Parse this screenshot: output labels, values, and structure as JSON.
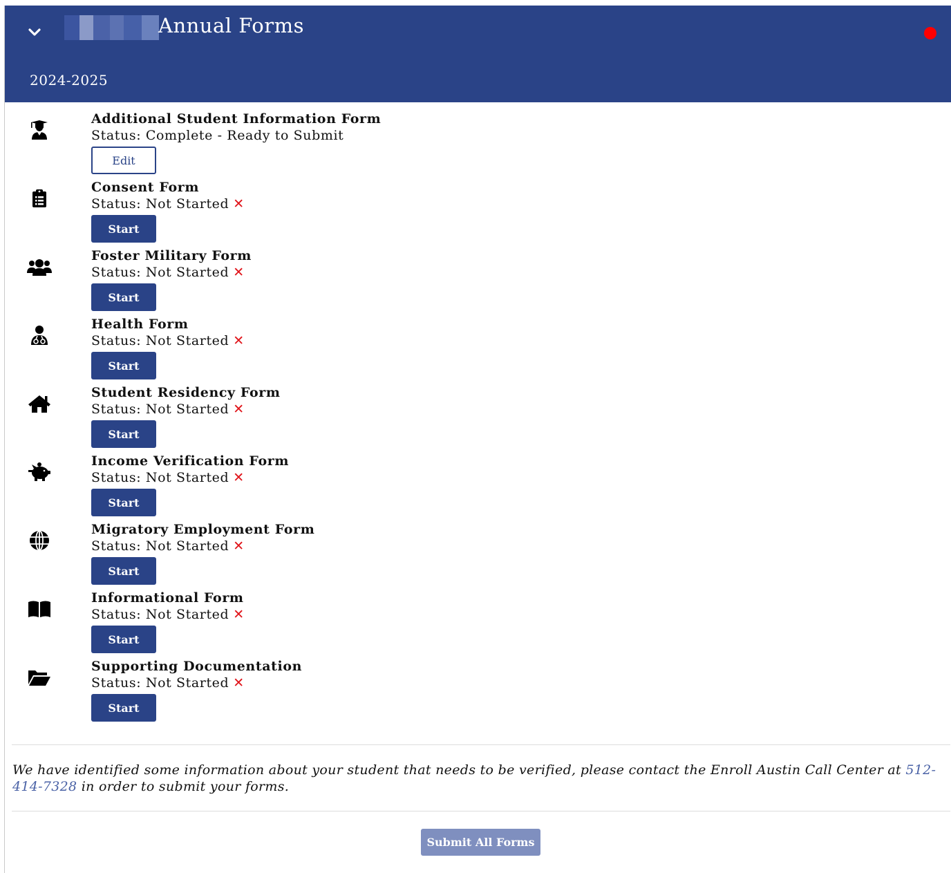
{
  "header": {
    "title": "Annual Forms",
    "year": "2024-2025",
    "collapse_icon": "chevron-down-icon",
    "status_color": "#ff0000",
    "brand_color": "#2a4387"
  },
  "forms": [
    {
      "name": "Additional Student Information Form",
      "status": "Status: Complete - Ready to Submit",
      "button": "Edit",
      "icon": "graduate-icon",
      "complete": true
    },
    {
      "name": "Consent Form",
      "status": "Status: Not Started",
      "button": "Start",
      "icon": "clipboard-list-icon",
      "complete": false
    },
    {
      "name": "Foster Military Form",
      "status": "Status: Not Started",
      "button": "Start",
      "icon": "users-icon",
      "complete": false
    },
    {
      "name": "Health Form",
      "status": "Status: Not Started",
      "button": "Start",
      "icon": "doctor-icon",
      "complete": false
    },
    {
      "name": "Student Residency Form",
      "status": "Status: Not Started",
      "button": "Start",
      "icon": "home-icon",
      "complete": false
    },
    {
      "name": "Income Verification Form",
      "status": "Status: Not Started",
      "button": "Start",
      "icon": "piggy-bank-icon",
      "complete": false
    },
    {
      "name": "Migratory Employment Form",
      "status": "Status: Not Started",
      "button": "Start",
      "icon": "globe-icon",
      "complete": false
    },
    {
      "name": "Informational Form",
      "status": "Status: Not Started",
      "button": "Start",
      "icon": "book-open-icon",
      "complete": false
    },
    {
      "name": "Supporting Documentation",
      "status": "Status: Not Started",
      "button": "Start",
      "icon": "folder-open-icon",
      "complete": false
    }
  ],
  "notice": {
    "before": "We have identified some information about your student that needs to be verified, please contact the Enroll Austin Call Center at ",
    "phone": "512-414-7328",
    "after": " in order to submit your forms."
  },
  "submit_label": "Submit All Forms"
}
